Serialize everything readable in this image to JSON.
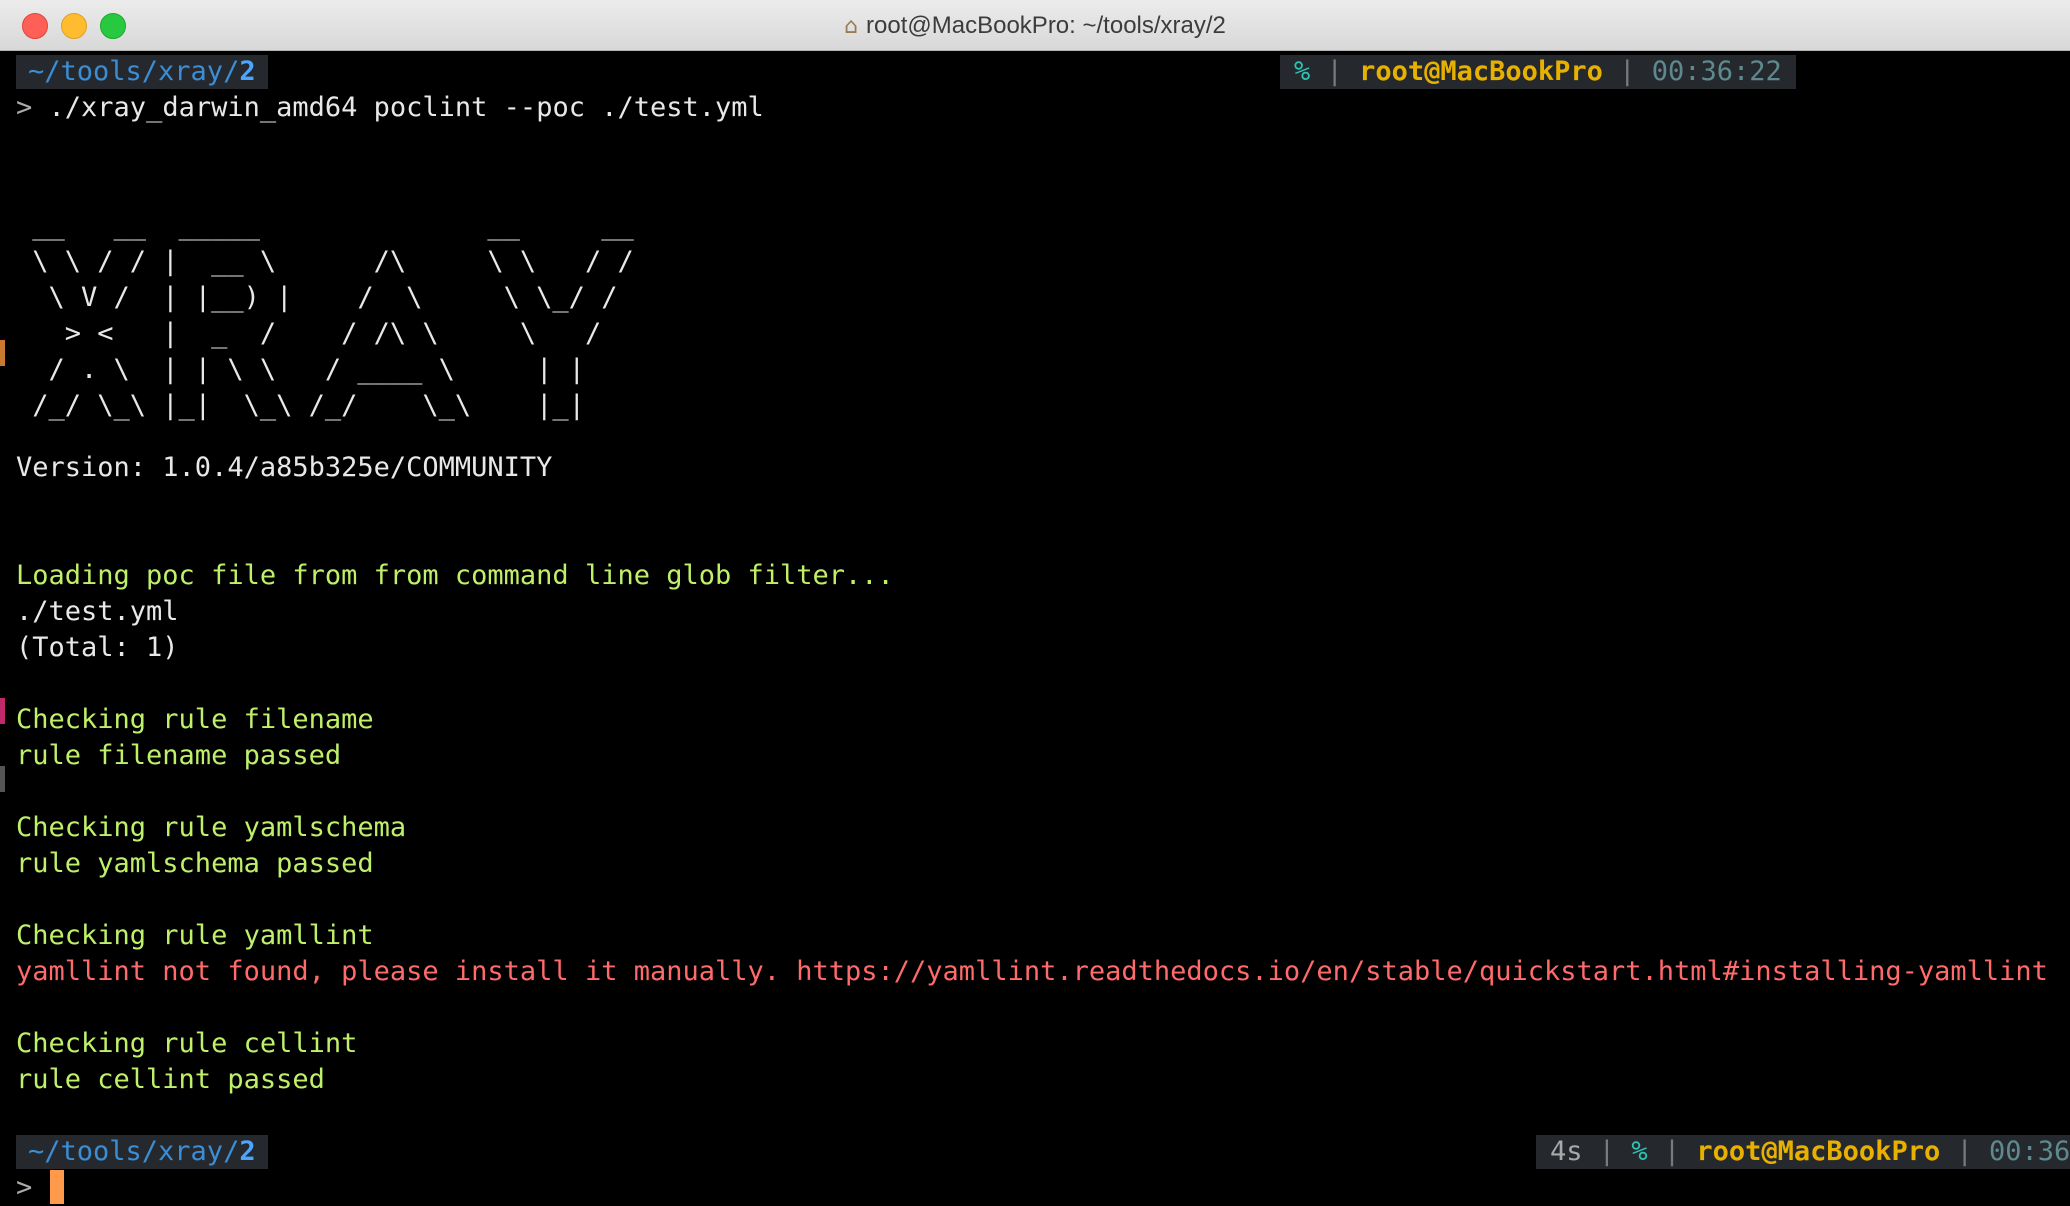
{
  "window": {
    "title": "root@MacBookPro: ~/tools/xray/2",
    "home_icon": "home-icon"
  },
  "top_prompt": {
    "path_prefix": "~/tools/xray/",
    "path_tail": "2",
    "percent": "%",
    "sep1": "|",
    "host": "root@MacBookPro",
    "sep2": "|",
    "time": "00:36:22"
  },
  "command": {
    "prompt": ">",
    "text": "./xray_darwin_amd64 poclint --poc ./test.yml"
  },
  "banner": [
    " __   __  _____              __     __",
    " \\ \\ / / |  __ \\      /\\     \\ \\   / /",
    "  \\ V /  | |__) |    /  \\     \\ \\_/ /",
    "   > <   |  _  /    / /\\ \\     \\   /",
    "  / . \\  | | \\ \\   / ____ \\     | |",
    " /_/ \\_\\ |_|  \\_\\ /_/    \\_\\    |_|"
  ],
  "version": "Version: 1.0.4/a85b325e/COMMUNITY",
  "output": {
    "loading": "Loading poc file from from command line glob filter...",
    "file": "./test.yml",
    "total": "(Total: 1)",
    "check_filename": "Checking rule filename",
    "pass_filename": "rule filename passed",
    "check_yamlschema": "Checking rule yamlschema",
    "pass_yamlschema": "rule yamlschema passed",
    "check_yamllint": "Checking rule yamllint",
    "error_yamllint": "yamllint not found, please install it manually. https://yamllint.readthedocs.io/en/stable/quickstart.html#installing-yamllint",
    "check_cellint": "Checking rule cellint",
    "pass_cellint": "rule cellint passed"
  },
  "bottom_prompt": {
    "path_prefix": "~/tools/xray/",
    "path_tail": "2",
    "duration": "4s",
    "sep0": "|",
    "percent": "%",
    "sep1": "|",
    "host": "root@MacBookPro",
    "sep2": "|",
    "time": "00:36",
    "prompt": ">"
  },
  "colors": {
    "background": "#000000",
    "success_text": "#bff06a",
    "error_text": "#ff6a6a",
    "path": "#4aa6ff",
    "host": "#e8b100",
    "cursor": "#ff9a4a"
  }
}
